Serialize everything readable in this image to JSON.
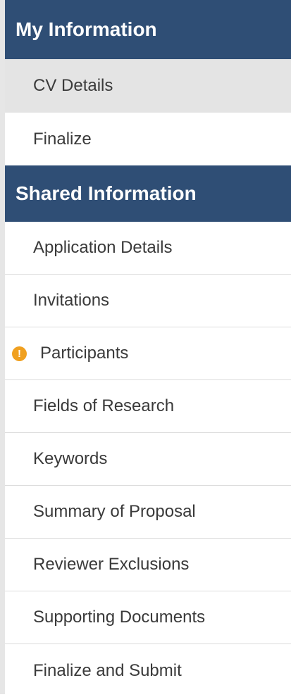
{
  "sections": {
    "my_information": {
      "title": "My Information",
      "items": [
        {
          "label": "CV Details"
        },
        {
          "label": "Finalize"
        }
      ]
    },
    "shared_information": {
      "title": "Shared Information",
      "items": [
        {
          "label": "Application Details"
        },
        {
          "label": "Invitations"
        },
        {
          "label": "Participants",
          "icon": "warning-icon",
          "icon_glyph": "!"
        },
        {
          "label": "Fields of Research"
        },
        {
          "label": "Keywords"
        },
        {
          "label": "Summary of Proposal"
        },
        {
          "label": "Reviewer Exclusions"
        },
        {
          "label": "Supporting Documents"
        },
        {
          "label": "Finalize and Submit"
        }
      ]
    }
  },
  "colors": {
    "header_bg": "#2f4e75",
    "active_bg": "#e4e4e4",
    "warning": "#f0a020"
  }
}
